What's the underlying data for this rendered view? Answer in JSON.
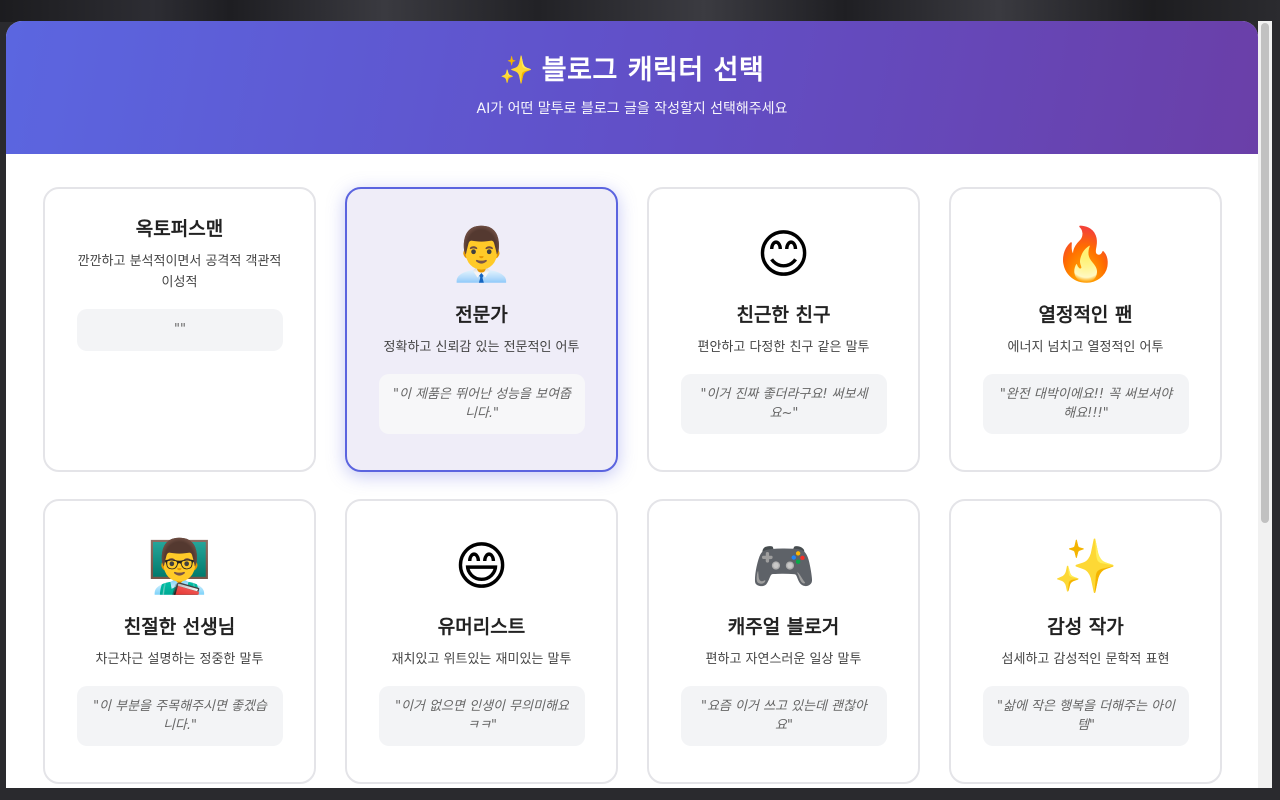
{
  "header": {
    "title_icon": "✨",
    "title": "블로그 캐릭터 선택",
    "subtitle": "AI가 어떤 말투로 블로그 글을 작성할지 선택해주세요",
    "gradient_start": "#5b66e0",
    "gradient_end": "#6a3fa8"
  },
  "accent_color": "#5b64df",
  "characters": [
    {
      "icon": "",
      "name": "옥토퍼스맨",
      "desc": "깐깐하고 분석적이면서 공격적 객관적 이성적",
      "quote": "\"\"",
      "selected": false
    },
    {
      "icon": "👨‍💼",
      "name": "전문가",
      "desc": "정확하고 신뢰감 있는 전문적인 어투",
      "quote": "\"이 제품은 뛰어난 성능을 보여줍니다.\"",
      "selected": true
    },
    {
      "icon": "😊",
      "name": "친근한 친구",
      "desc": "편안하고 다정한 친구 같은 말투",
      "quote": "\"이거 진짜 좋더라구요! 써보세요~\"",
      "selected": false
    },
    {
      "icon": "🔥",
      "name": "열정적인 팬",
      "desc": "에너지 넘치고 열정적인 어투",
      "quote": "\"완전 대박이에요!! 꼭 써보셔야해요!!!\"",
      "selected": false
    },
    {
      "icon": "👨‍🏫",
      "name": "친절한 선생님",
      "desc": "차근차근 설명하는 정중한 말투",
      "quote": "\"이 부분을 주목해주시면 좋겠습니다.\"",
      "selected": false
    },
    {
      "icon": "😄",
      "name": "유머리스트",
      "desc": "재치있고 위트있는 재미있는 말투",
      "quote": "\"이거 없으면 인생이 무의미해요ㅋㅋ\"",
      "selected": false
    },
    {
      "icon": "🎮",
      "name": "캐주얼 블로거",
      "desc": "편하고 자연스러운 일상 말투",
      "quote": "\"요즘 이거 쓰고 있는데 괜찮아요\"",
      "selected": false
    },
    {
      "icon": "✨",
      "name": "감성 작가",
      "desc": "섬세하고 감성적인 문학적 표현",
      "quote": "\"삶에 작은 행복을 더해주는 아이템\"",
      "selected": false
    }
  ]
}
